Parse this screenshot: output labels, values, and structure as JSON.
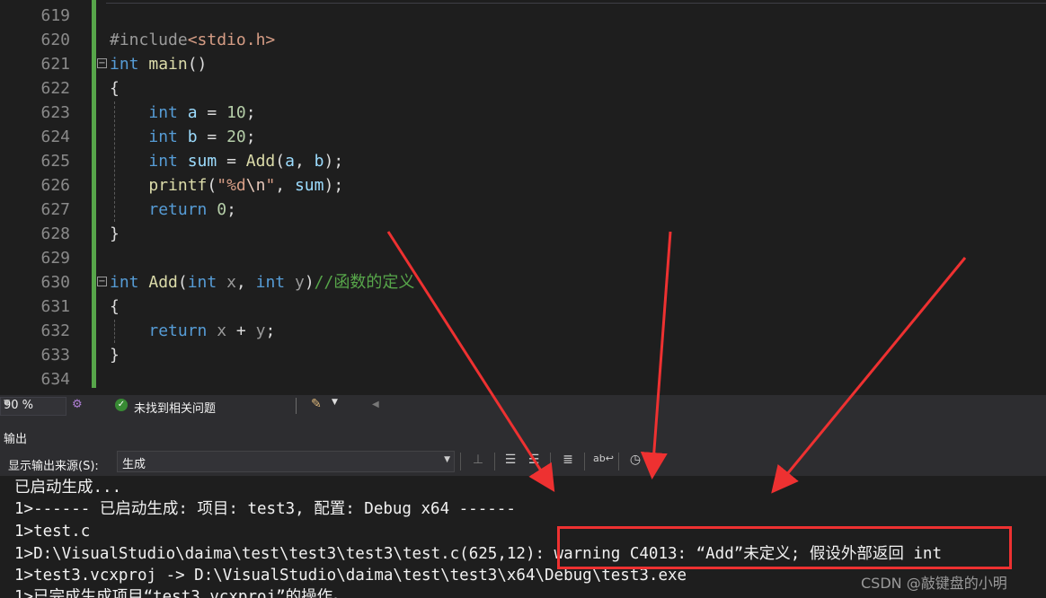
{
  "editor": {
    "line_numbers": [
      "619",
      "620",
      "621",
      "622",
      "623",
      "624",
      "625",
      "626",
      "627",
      "628",
      "629",
      "630",
      "631",
      "632",
      "633",
      "634"
    ],
    "code": {
      "l620": {
        "pp": "#include",
        "open": "<",
        "hdr": "stdio.h",
        "close": ">"
      },
      "l621": {
        "kw": "int",
        "fn": "main",
        "rest": "()"
      },
      "l622": {
        "text": "{"
      },
      "l623": {
        "kw": "int",
        "var": "a",
        "eq": " = ",
        "num": "10",
        "end": ";"
      },
      "l624": {
        "kw": "int",
        "var": "b",
        "eq": " = ",
        "num": "20",
        "end": ";"
      },
      "l625": {
        "kw": "int",
        "var": "sum",
        "eq": " = ",
        "fn": "Add",
        "p1": "(",
        "a": "a",
        ",": ", ",
        "b": "b",
        "end": ");"
      },
      "l626": {
        "fn": "printf",
        "p1": "(",
        "s1": "\"%d",
        "esc": "\\n",
        "s2": "\"",
        ",": ", ",
        "var": "sum",
        "end": ");"
      },
      "l627": {
        "kw": "return",
        "num": "0",
        "end": ";"
      },
      "l628": {
        "text": "}"
      },
      "l630": {
        "kw1": "int",
        "fn": "Add",
        "p1": "(",
        "kw2": "int",
        "x": "x",
        ",": ", ",
        "kw3": "int",
        "y": "y",
        "p2": ")",
        "cmt": "//函数的定义"
      },
      "l631": {
        "text": "{"
      },
      "l632": {
        "kw": "return",
        "x": "x",
        "op": " + ",
        "y": "y",
        "end": ";"
      },
      "l633": {
        "text": "}"
      }
    }
  },
  "status": {
    "zoom": "90 %",
    "issues": "未找到相关问题"
  },
  "output_panel": {
    "title": "输出",
    "source_label": "显示输出来源(S):",
    "source_value": "生成",
    "lines": [
      "已启动生成...",
      "1>------ 已启动生成: 项目: test3, 配置: Debug x64 ------",
      "1>test.c",
      "1>D:\\VisualStudio\\daima\\test\\test3\\test3\\test.c(625,12): warning C4013: “Add”未定义; 假设外部返回 int",
      "1>test3.vcxproj -> D:\\VisualStudio\\daima\\test\\test3\\x64\\Debug\\test3.exe",
      "1>已完成生成项目“test3.vcxproj”的操作。"
    ]
  },
  "watermark": "CSDN @敲键盘的小明",
  "colors": {
    "keyword": "#569cd6",
    "function": "#dcdcaa",
    "variable": "#9cdcfe",
    "number": "#b5cea8",
    "comment": "#57a64a",
    "annotation": "#ee3131"
  },
  "icons": [
    "perf-tips-icon",
    "check-circle-icon",
    "brush-icon",
    "find-message-icon",
    "previous-message-icon",
    "next-message-icon",
    "clear-all-icon",
    "word-wrap-icon",
    "clock-icon"
  ]
}
